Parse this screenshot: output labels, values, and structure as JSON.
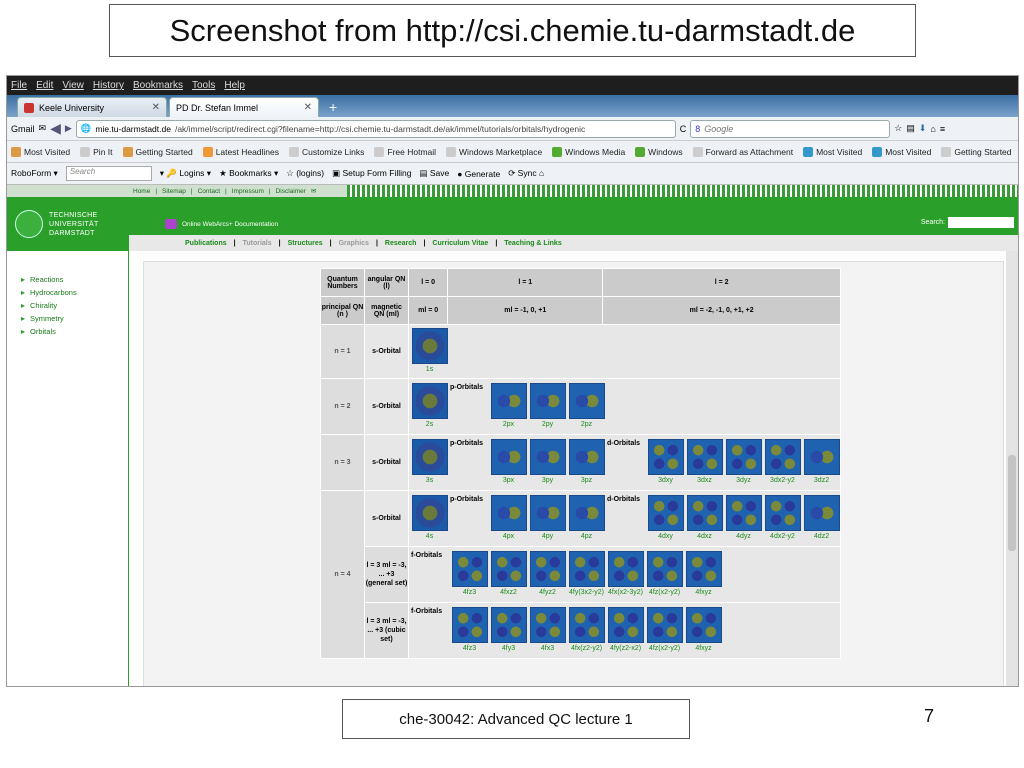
{
  "slide": {
    "title": "Screenshot from http://csi.chemie.tu-darmstadt.de",
    "footer": "che-30042: Advanced QC lecture 1",
    "page_number": "7"
  },
  "browser": {
    "menu": [
      "File",
      "Edit",
      "View",
      "History",
      "Bookmarks",
      "Tools",
      "Help"
    ],
    "tabs": [
      {
        "label": "Keele University"
      },
      {
        "label": "PD Dr. Stefan Immel"
      }
    ],
    "nav": {
      "gmail": "Gmail",
      "url_host": "mie.tu-darmstadt.de",
      "url_path": "/ak/immel/script/redirect.cgi?filename=http://csi.chemie.tu-darmstadt.de/ak/immel/tutorials/orbitals/hydrogenic",
      "search_placeholder": "Google"
    },
    "bookmarks": [
      "Most Visited",
      "Pin It",
      "Getting Started",
      "Latest Headlines",
      "Customize Links",
      "Free Hotmail",
      "Windows Marketplace",
      "Windows Media",
      "Windows",
      "Forward as Attachment",
      "Most Visited",
      "Most Visited",
      "Getting Started"
    ],
    "roboform": {
      "label": "RoboForm",
      "search_placeholder": "Search",
      "items": [
        "Logins",
        "Bookmarks",
        "(logins)",
        "Setup Form Filling",
        "Save",
        "Generate",
        "Sync"
      ]
    }
  },
  "site": {
    "top_links": [
      "Home",
      "Sitemap",
      "Contact",
      "Impressum",
      "Disclaimer"
    ],
    "logo": [
      "TECHNISCHE",
      "UNIVERSITÄT",
      "DARMSTADT"
    ],
    "subtitle": "Online WebArcs+ Documentation",
    "search_label": "Search:",
    "nav": [
      {
        "label": "Publications",
        "active": true
      },
      {
        "label": "Tutorials",
        "active": false
      },
      {
        "label": "Structures",
        "active": true
      },
      {
        "label": "Graphics",
        "active": false
      },
      {
        "label": "Research",
        "active": true
      },
      {
        "label": "Curriculum Vitae",
        "active": true
      },
      {
        "label": "Teaching & Links",
        "active": true
      }
    ],
    "sidebar": [
      "Reactions",
      "Hydrocarbons",
      "Chirality",
      "Symmetry",
      "Orbitals"
    ]
  },
  "table": {
    "h1": [
      "Quantum Numbers",
      "angular QN (l)",
      "l = 0",
      "l = 1",
      "l = 2"
    ],
    "h2": [
      "principal QN (n )",
      "magnetic QN (ml)",
      "ml = 0",
      "ml = -1, 0, +1",
      "ml = -2, -1, 0, +1, +2"
    ],
    "n1": "n = 1",
    "n2": "n = 2",
    "n3": "n = 3",
    "n4": "n = 4",
    "s_label": "s-Orbital",
    "p_label": "p-Orbitals",
    "d_label": "d-Orbitals",
    "f_label": "f-Orbitals",
    "f_general": "l = 3 ml = -3, ... +3 (general set)",
    "f_cubic": "l = 3 ml = -3, ... +3 (cubic set)",
    "caps": {
      "r1": [
        "1s"
      ],
      "r2": [
        "2s",
        "2px",
        "2py",
        "2pz"
      ],
      "r3": [
        "3s",
        "3px",
        "3py",
        "3pz",
        "3dxy",
        "3dxz",
        "3dyz",
        "3dx2-y2",
        "3dz2"
      ],
      "r4": [
        "4s",
        "4px",
        "4py",
        "4pz",
        "4dxy",
        "4dxz",
        "4dyz",
        "4dx2-y2",
        "4dz2"
      ],
      "r5": [
        "4fz3",
        "4fxz2",
        "4fyz2",
        "4fy(3x2-y2)",
        "4fx(x2-3y2)",
        "4fz(x2-y2)",
        "4fxyz"
      ],
      "r6": [
        "4fz3",
        "4fy3",
        "4fx3",
        "4fx(z2-y2)",
        "4fy(z2-x2)",
        "4fz(x2-y2)",
        "4fxyz"
      ]
    }
  }
}
